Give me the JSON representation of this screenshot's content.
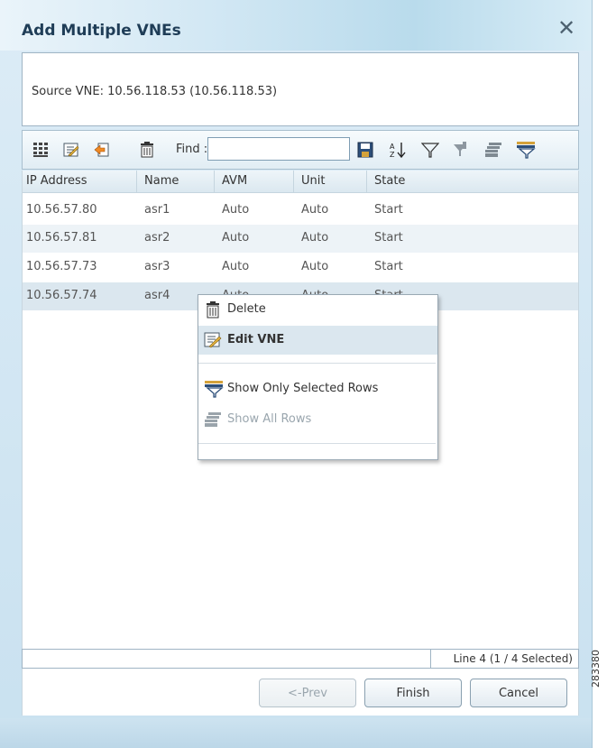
{
  "dialog": {
    "title": "Add Multiple VNEs",
    "close_glyph": "✕",
    "source_text": "Source VNE: 10.56.118.53 (10.56.118.53)"
  },
  "toolbar": {
    "find_label": "Find :",
    "find_value": "",
    "icons": [
      "columns-icon",
      "edit-icon",
      "import-icon",
      "delete-icon",
      "save-icon",
      "sort-az-icon",
      "filter-icon",
      "filter-clear-icon",
      "show-all-rows-icon",
      "show-selected-rows-icon"
    ]
  },
  "table": {
    "columns": [
      "IP Address",
      "Name",
      "AVM",
      "Unit",
      "State"
    ],
    "rows": [
      [
        "10.56.57.80",
        "asr1",
        "Auto",
        "Auto",
        "Start"
      ],
      [
        "10.56.57.81",
        "asr2",
        "Auto",
        "Auto",
        "Start"
      ],
      [
        "10.56.57.73",
        "asr3",
        "Auto",
        "Auto",
        "Start"
      ],
      [
        "10.56.57.74",
        "asr4",
        "Auto",
        "Auto",
        "Start"
      ]
    ],
    "selected_row": 4
  },
  "context_menu": {
    "items": [
      {
        "label": "Delete",
        "icon": "trash-icon",
        "state": "normal"
      },
      {
        "label": "Edit VNE",
        "icon": "edit-icon",
        "state": "highlighted"
      },
      {
        "label": "Show Only Selected Rows",
        "icon": "filter-selected-icon",
        "state": "normal"
      },
      {
        "label": "Show All Rows",
        "icon": "show-all-icon",
        "state": "disabled"
      }
    ]
  },
  "status": {
    "text": "Line 4 (1 / 4 Selected)"
  },
  "buttons": {
    "prev": "<-Prev",
    "finish": "Finish",
    "cancel": "Cancel"
  },
  "figure_id": "283380",
  "colors": {
    "accent": "#1f3d57",
    "row_highlight": "#dbe7ef"
  }
}
